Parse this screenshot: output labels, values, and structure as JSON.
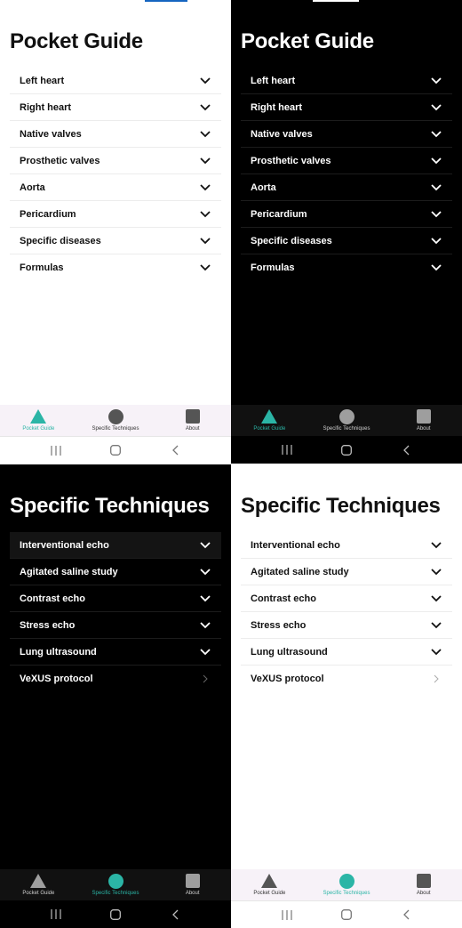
{
  "colors": {
    "accent": "#2bb5a6",
    "inactive_light": "#555555",
    "inactive_dark": "#9e9e9e"
  },
  "screen1": {
    "title": "Pocket Guide",
    "items": [
      {
        "label": "Left heart",
        "icon": "chevron-down"
      },
      {
        "label": "Right heart",
        "icon": "chevron-down"
      },
      {
        "label": "Native valves",
        "icon": "chevron-down"
      },
      {
        "label": "Prosthetic valves",
        "icon": "chevron-down"
      },
      {
        "label": "Aorta",
        "icon": "chevron-down"
      },
      {
        "label": "Pericardium",
        "icon": "chevron-down"
      },
      {
        "label": "Specific diseases",
        "icon": "chevron-down"
      },
      {
        "label": "Formulas",
        "icon": "chevron-down"
      }
    ]
  },
  "screen2": {
    "title": "Specific Techniques",
    "items": [
      {
        "label": "Interventional echo",
        "icon": "chevron-down"
      },
      {
        "label": "Agitated saline study",
        "icon": "chevron-down"
      },
      {
        "label": "Contrast echo",
        "icon": "chevron-down"
      },
      {
        "label": "Stress echo",
        "icon": "chevron-down"
      },
      {
        "label": "Lung ultrasound",
        "icon": "chevron-down"
      },
      {
        "label": "VeXUS protocol",
        "icon": "chevron-right"
      }
    ]
  },
  "tabs": [
    {
      "label": "Pocket Guide",
      "icon": "triangle"
    },
    {
      "label": "Specific Techniques",
      "icon": "circle"
    },
    {
      "label": "About",
      "icon": "square"
    }
  ]
}
